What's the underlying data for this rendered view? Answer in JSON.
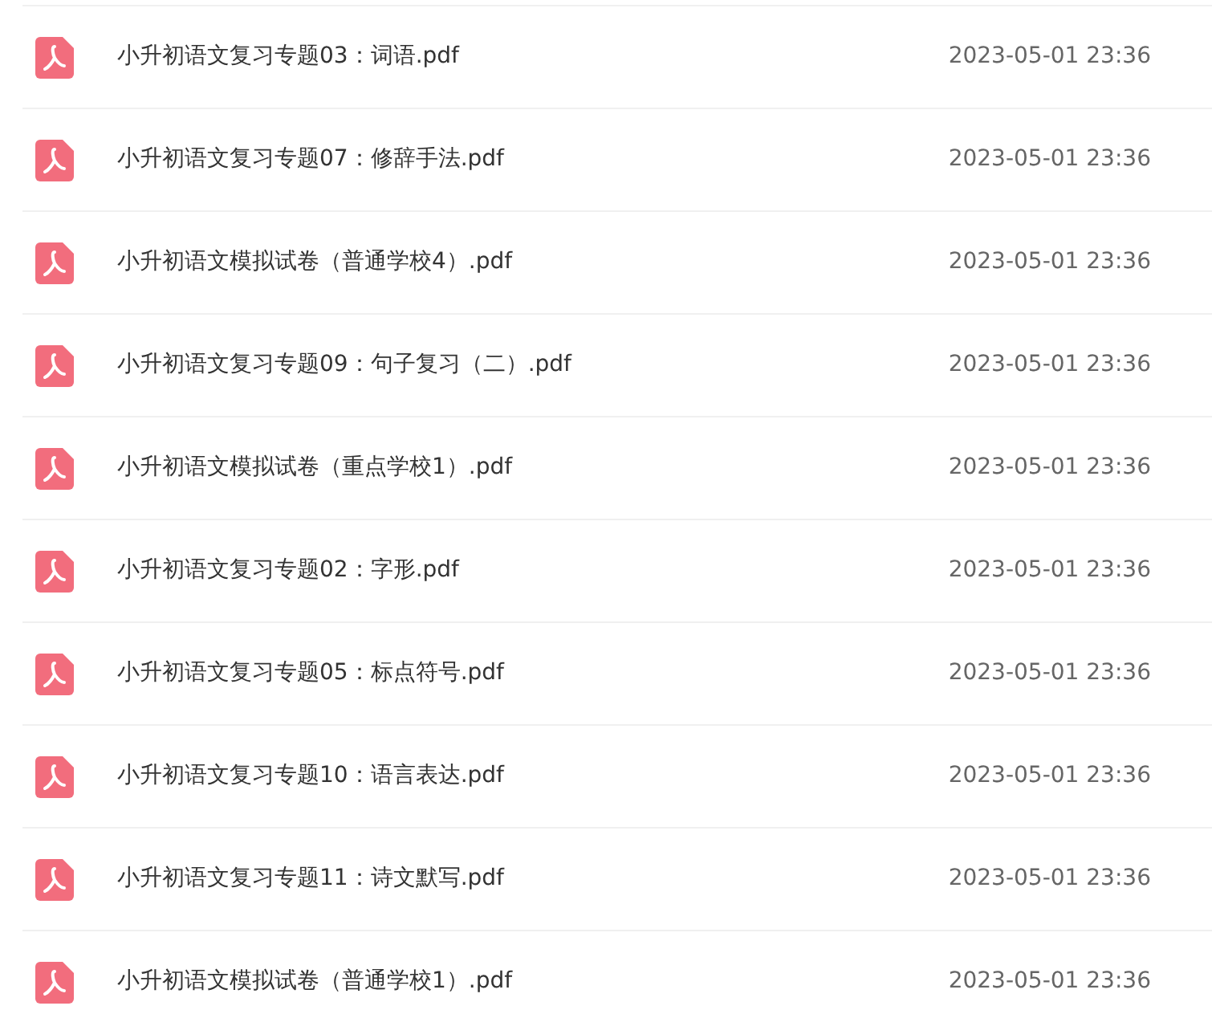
{
  "files": [
    {
      "name": "小升初语文复习专题03：词语.pdf",
      "date": "2023-05-01 23:36"
    },
    {
      "name": "小升初语文复习专题07：修辞手法.pdf",
      "date": "2023-05-01 23:36"
    },
    {
      "name": "小升初语文模拟试卷（普通学校4）.pdf",
      "date": "2023-05-01 23:36"
    },
    {
      "name": "小升初语文复习专题09：句子复习（二）.pdf",
      "date": "2023-05-01 23:36"
    },
    {
      "name": "小升初语文模拟试卷（重点学校1）.pdf",
      "date": "2023-05-01 23:36"
    },
    {
      "name": "小升初语文复习专题02：字形.pdf",
      "date": "2023-05-01 23:36"
    },
    {
      "name": "小升初语文复习专题05：标点符号.pdf",
      "date": "2023-05-01 23:36"
    },
    {
      "name": "小升初语文复习专题10：语言表达.pdf",
      "date": "2023-05-01 23:36"
    },
    {
      "name": "小升初语文复习专题11：诗文默写.pdf",
      "date": "2023-05-01 23:36"
    },
    {
      "name": "小升初语文模拟试卷（普通学校1）.pdf",
      "date": "2023-05-01 23:36"
    }
  ]
}
